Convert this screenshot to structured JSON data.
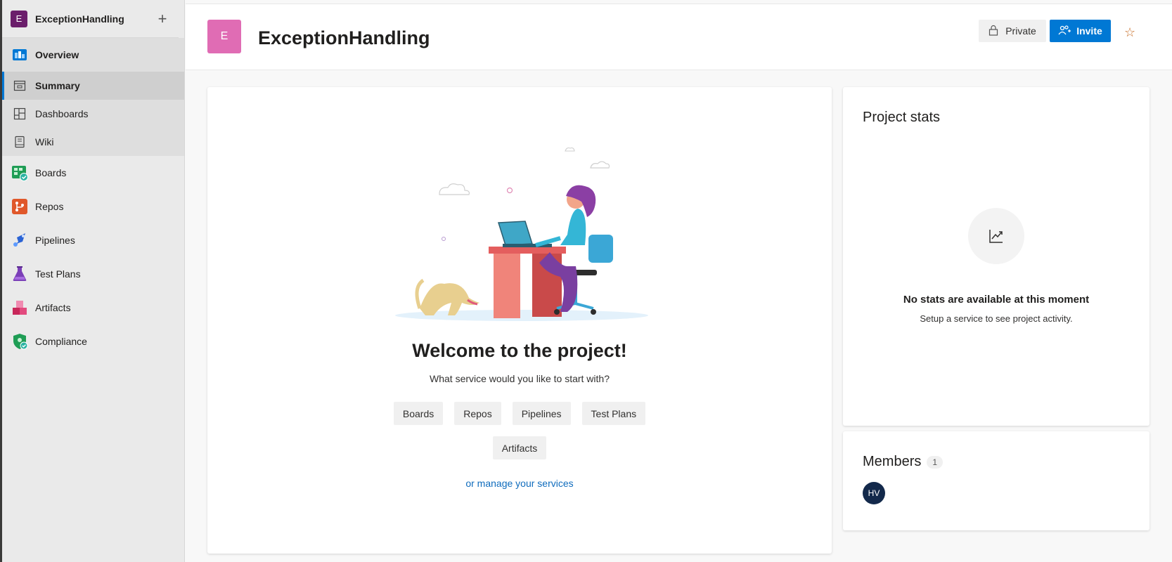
{
  "project": {
    "initial": "E",
    "name": "ExceptionHandling"
  },
  "sidebar": {
    "add_label": "+",
    "items": [
      {
        "label": "Overview",
        "icon": "overview-icon"
      },
      {
        "label": "Summary",
        "icon": "summary-icon"
      },
      {
        "label": "Dashboards",
        "icon": "dashboards-icon"
      },
      {
        "label": "Wiki",
        "icon": "wiki-icon"
      },
      {
        "label": "Boards",
        "icon": "boards-icon"
      },
      {
        "label": "Repos",
        "icon": "repos-icon"
      },
      {
        "label": "Pipelines",
        "icon": "pipelines-icon"
      },
      {
        "label": "Test Plans",
        "icon": "test-plans-icon"
      },
      {
        "label": "Artifacts",
        "icon": "artifacts-icon"
      },
      {
        "label": "Compliance",
        "icon": "compliance-icon"
      }
    ]
  },
  "header": {
    "title": "ExceptionHandling",
    "private_label": "Private",
    "invite_label": "Invite",
    "star": "☆"
  },
  "welcome": {
    "title": "Welcome to the project!",
    "subtitle": "What service would you like to start with?",
    "services": [
      "Boards",
      "Repos",
      "Pipelines",
      "Test Plans",
      "Artifacts"
    ],
    "manage_link": "or manage your services"
  },
  "stats": {
    "title": "Project stats",
    "message": "No stats are available at this moment",
    "sub": "Setup a service to see project activity."
  },
  "members": {
    "title": "Members",
    "count": "1",
    "avatar_initials": "HV"
  },
  "colors": {
    "accent": "#0078d4",
    "project_avatar": "#6b1e6b",
    "header_avatar": "#e06cb4"
  }
}
